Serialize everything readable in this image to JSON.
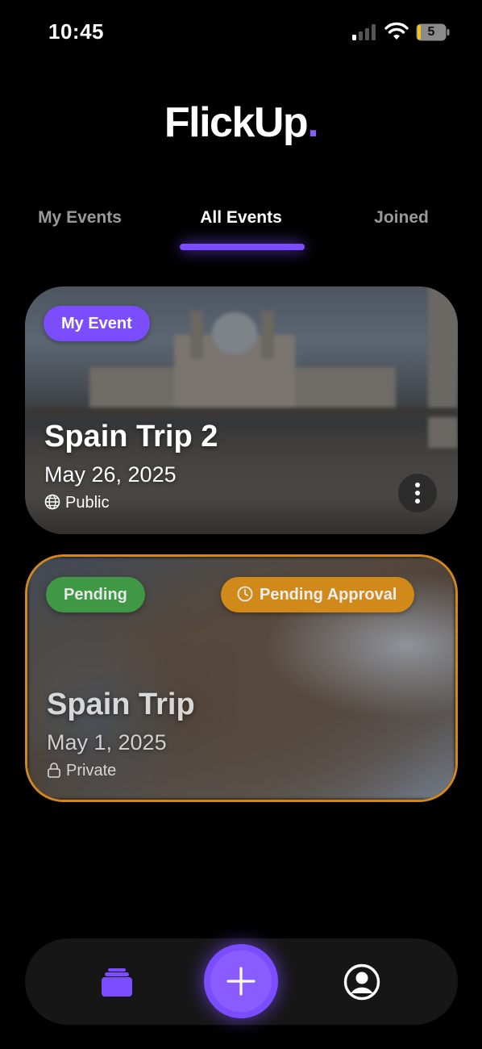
{
  "status_bar": {
    "time": "10:45",
    "battery": "5"
  },
  "app": {
    "logo_text": "FlickUp",
    "logo_dot": ".",
    "accent_color": "#7c4dff"
  },
  "tabs": [
    {
      "label": "My Events",
      "active": false
    },
    {
      "label": "All Events",
      "active": true
    },
    {
      "label": "Joined",
      "active": false
    }
  ],
  "events": [
    {
      "badge": "My Event",
      "title": "Spain Trip 2",
      "date": "May 26, 2025",
      "privacy": "Public",
      "privacy_icon": "globe-icon",
      "menu_icon": "more-vertical-icon"
    },
    {
      "badge": "Pending",
      "status_badge": "Pending Approval",
      "status_icon": "clock-icon",
      "title": "Spain Trip",
      "date": "May 1, 2025",
      "privacy": "Private",
      "privacy_icon": "lock-icon",
      "border_color": "#d1881d"
    }
  ],
  "bottom_nav": {
    "items": [
      {
        "icon": "events-stack-icon",
        "active": true
      },
      {
        "icon": "plus-icon"
      },
      {
        "icon": "profile-icon"
      }
    ]
  }
}
